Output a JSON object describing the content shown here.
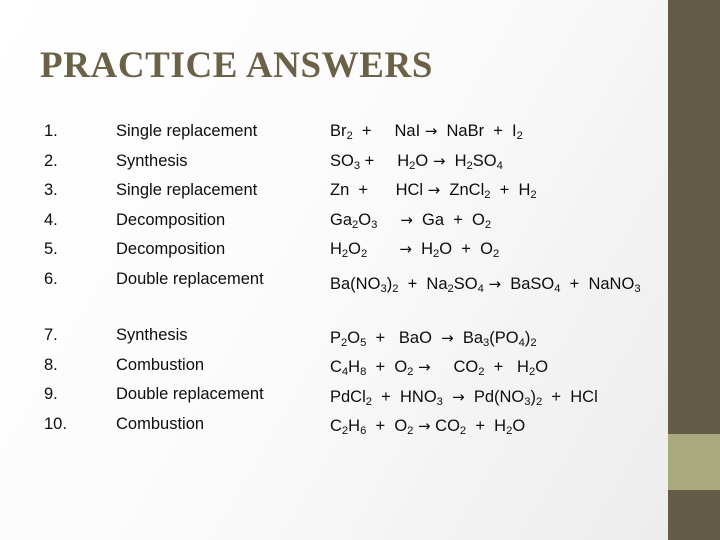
{
  "slide": {
    "title": "PRACTICE ANSWERS",
    "colors": {
      "title": "#6b6147",
      "bar_dark": "#645c47",
      "bar_light": "#a9a97e",
      "text": "#0d0d0d",
      "background": "#ffffff"
    }
  },
  "answers": [
    {
      "number": "1.",
      "label": "Single replacement"
    },
    {
      "number": "2.",
      "label": "Synthesis"
    },
    {
      "number": "3.",
      "label": "Single replacement"
    },
    {
      "number": "4.",
      "label": "Decomposition"
    },
    {
      "number": "5.",
      "label": "Decomposition"
    },
    {
      "number": "6.",
      "label": "Double replacement"
    },
    {
      "number": "7.",
      "label": "Synthesis"
    },
    {
      "number": "8.",
      "label": "Combustion"
    },
    {
      "number": "9.",
      "label": "Double replacement"
    },
    {
      "number": "10.",
      "label": "Combustion"
    }
  ],
  "equations": [
    {
      "text": "Br2  +     NaI →  NaBr  +  I2",
      "plain": "Br2 + NaI -> NaBr + I2"
    },
    {
      "text": "SO3 +     H2O →  H2SO4",
      "plain": "SO3 + H2O -> H2SO4"
    },
    {
      "text": "Zn  +      HCl →  ZnCl2  +  H2",
      "plain": "Zn + HCl -> ZnCl2 + H2"
    },
    {
      "text": "Ga2O3     →  Ga  +  O2",
      "plain": "Ga2O3 -> Ga + O2"
    },
    {
      "text": "H2O2       →  H2O  +  O2",
      "plain": "H2O2 -> H2O + O2"
    },
    {
      "text": "Ba(NO3)2  +  Na2SO4 →  BaSO4  +  NaNO3",
      "plain": "Ba(NO3)2 + Na2SO4 -> BaSO4 + NaNO3"
    },
    {
      "text": "P2O5  +   BaO  →  Ba3(PO4)2",
      "plain": "P2O5 + BaO -> Ba3(PO4)2"
    },
    {
      "text": "C4H8  +  O2 →     CO2  +   H2O",
      "plain": "C4H8 + O2 -> CO2 + H2O"
    },
    {
      "text": "PdCl2  +  HNO3  →  Pd(NO3)2  +  HCl",
      "plain": "PdCl2 + HNO3 -> Pd(NO3)2 + HCl"
    },
    {
      "text": "C2H6  +  O2 → CO2  +  H2O",
      "plain": "C2H6 + O2 -> CO2 + H2O"
    }
  ]
}
